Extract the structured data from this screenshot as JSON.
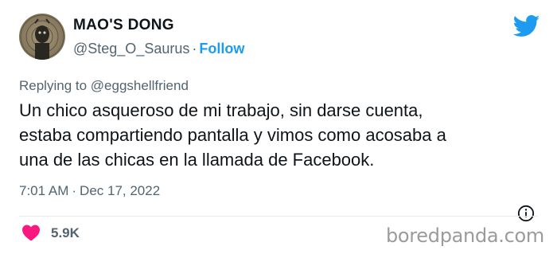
{
  "author": {
    "display_name": "MAO'S DONG",
    "handle": "@Steg_O_Saurus",
    "separator": "·",
    "follow_label": "Follow",
    "avatar_icon": "avatar-image"
  },
  "brand": {
    "icon": "twitter-bird-icon",
    "color": "#1d9bf0"
  },
  "reply": {
    "prefix": "Replying to",
    "mention": "@eggshellfriend"
  },
  "tweet": {
    "line1": "Un chico asqueroso de mi trabajo, sin darse cuenta,",
    "line2": "estaba compartiendo pantalla y vimos como acosaba a",
    "line3": "una de las chicas en la llamada de Facebook."
  },
  "meta": {
    "time": "7:01 AM",
    "separator": "·",
    "date": "Dec 17, 2022",
    "info_icon": "info-icon"
  },
  "actions": {
    "like_icon": "heart-icon",
    "like_color": "#f91880",
    "like_count": "5.9K"
  },
  "watermark": {
    "text": "boredpanda.com"
  }
}
